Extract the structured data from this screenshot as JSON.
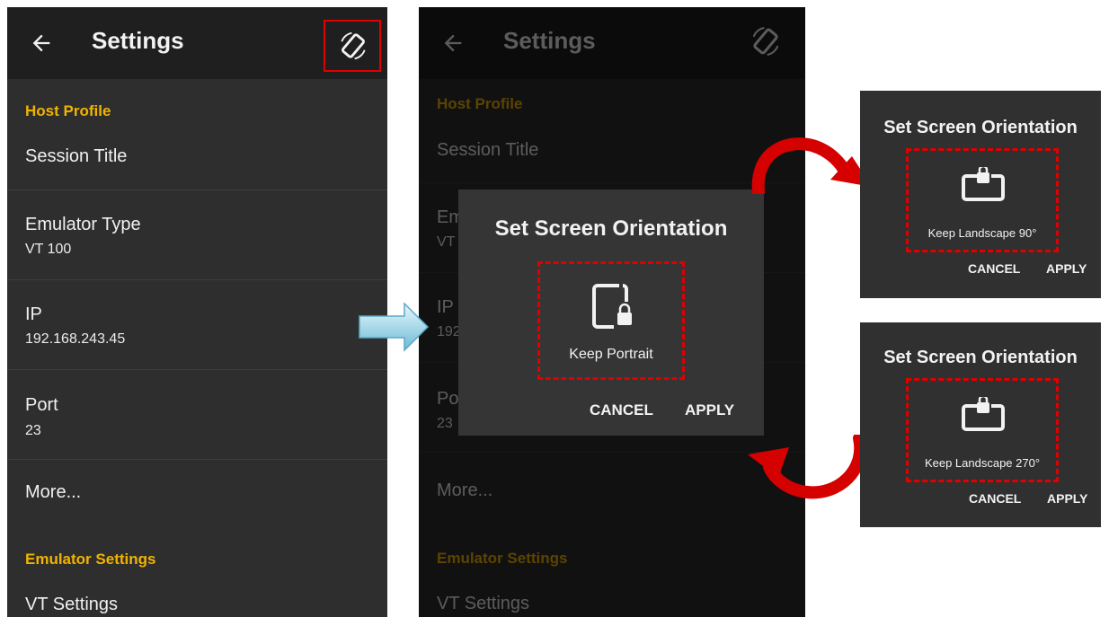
{
  "settings_screen": {
    "title": "Settings",
    "sections": {
      "host_profile": "Host Profile",
      "emulator_settings": "Emulator Settings"
    },
    "items": {
      "session_title": {
        "label": "Session Title"
      },
      "emulator_type": {
        "label": "Emulator Type",
        "value": "VT 100"
      },
      "ip": {
        "label": "IP",
        "value": "192.168.243.45"
      },
      "port": {
        "label": "Port",
        "value": "23"
      },
      "more": {
        "label": "More..."
      },
      "vt_settings": {
        "label": "VT Settings"
      }
    },
    "partial_labels": {
      "emulator_type": "Em",
      "emulator_value": "VT",
      "ip": "IP",
      "ip_value": "192",
      "port": "Po",
      "port_value": "23"
    }
  },
  "orientation_dialog": {
    "title": "Set Screen Orientation",
    "option_label": "Keep Portrait",
    "cancel_label": "CANCEL",
    "apply_label": "APPLY"
  },
  "landscape_90_dialog": {
    "title": "Set Screen Orientation",
    "option_label": "Keep Landscape 90°",
    "cancel_label": "CANCEL",
    "apply_label": "APPLY"
  },
  "landscape_270_dialog": {
    "title": "Set Screen Orientation",
    "option_label": "Keep Landscape 270°",
    "cancel_label": "CANCEL",
    "apply_label": "APPLY"
  },
  "colors": {
    "accent": "#f0b400",
    "highlight": "#e00000",
    "background": "#2e2e2e",
    "appbar": "#1f1f1f"
  },
  "icons": [
    "back-arrow-icon",
    "screen-rotation-icon",
    "portrait-lock-icon",
    "landscape-lock-icon",
    "right-arrow-icon",
    "curved-arrow-icon"
  ]
}
